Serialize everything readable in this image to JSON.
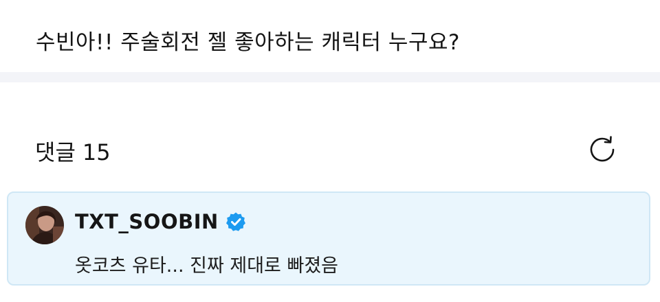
{
  "post": {
    "title": "수빈아!! 주술회전 젤 좋아하는 캐릭터 누구요?"
  },
  "comments_section": {
    "label": "댓글",
    "count": "15",
    "refresh_icon": "refresh-icon"
  },
  "comments": [
    {
      "author": "TXT_SOOBIN",
      "verified": true,
      "verified_icon": "verified-badge-icon",
      "text": "옷코츠 유타... 진짜 제대로 빠졌음"
    }
  ],
  "colors": {
    "divider": "#f3f4f8",
    "comment_bg": "#eaf6fd",
    "comment_border": "#cfe7f5",
    "verified": "#1d9bf0"
  }
}
